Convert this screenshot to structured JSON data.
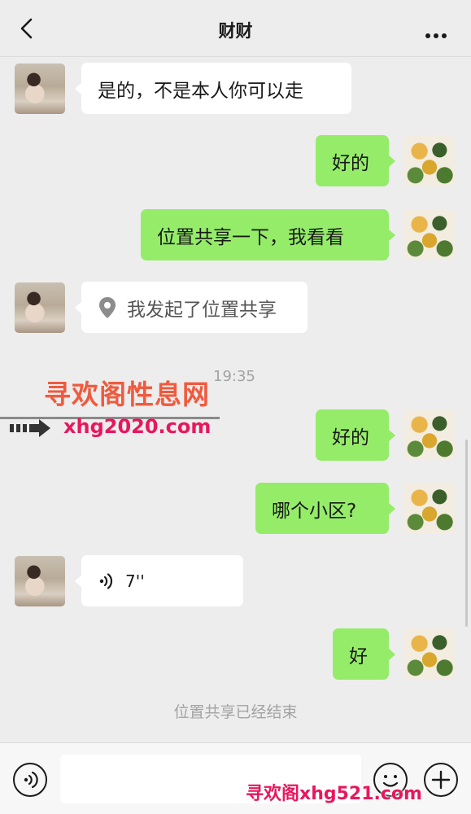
{
  "nav": {
    "title": "财财",
    "back_icon": "chevron-left-icon",
    "more_icon": "more-dots-icon"
  },
  "messages": [
    {
      "side": "left",
      "type": "text",
      "text": "是的，不是本人你可以走"
    },
    {
      "side": "right",
      "type": "text",
      "text": "好的"
    },
    {
      "side": "right",
      "type": "text",
      "text": "位置共享一下，我看看"
    },
    {
      "side": "left",
      "type": "location-share",
      "icon": "location-pin-icon",
      "text": "我发起了位置共享"
    },
    {
      "side": "right",
      "type": "text",
      "text": "好的"
    },
    {
      "side": "right",
      "type": "text",
      "text": "哪个小区?"
    },
    {
      "side": "left",
      "type": "voice",
      "icon": "voice-wave-icon",
      "text": "7''"
    },
    {
      "side": "right",
      "type": "text",
      "text": "好"
    }
  ],
  "timestamp": "19:35",
  "system_notice": "位置共享已经结束",
  "watermark": {
    "line1": "寻欢阁性息网",
    "line2": "xhg2020.com",
    "line3": "寻欢阁xhg521.com"
  },
  "input_bar": {
    "voice_icon": "voice-toggle-icon",
    "emoji_icon": "emoji-icon",
    "plus_icon": "plus-icon",
    "placeholder": ""
  },
  "colors": {
    "background": "#ededed",
    "self_bubble": "#95ec69",
    "other_bubble": "#ffffff"
  }
}
